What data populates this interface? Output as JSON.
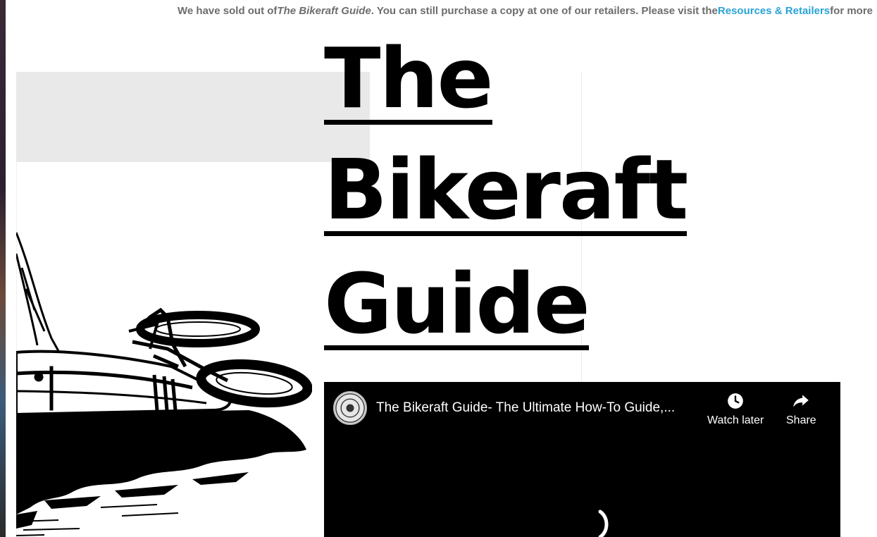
{
  "notice": {
    "prefix": "We have sold out of ",
    "book_title": "The Bikeraft Guide",
    "middle": ". You can still purchase a copy at one of our retailers. Please visit the ",
    "link_text": "Resources & Retailers",
    "suffix": " for more"
  },
  "hero": {
    "title_lines": [
      "The",
      "Bikeraft",
      "Guide"
    ]
  },
  "video": {
    "title": "The Bikeraft Guide- The Ultimate How-To Guide,...",
    "watch_later_label": "Watch later",
    "share_label": "Share",
    "watch_later_icon": "clock-icon",
    "share_icon": "share-arrow-icon"
  },
  "colors": {
    "link": "#29a3d6",
    "notice_text": "#6d6d6d",
    "title": "#000000",
    "video_bg": "#000000"
  }
}
